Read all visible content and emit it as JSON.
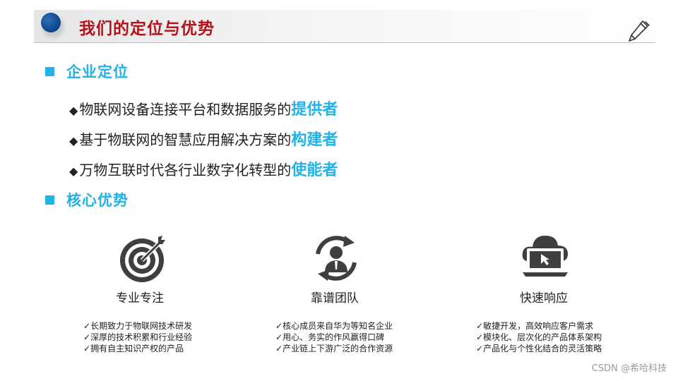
{
  "header": {
    "title": "我们的定位与优势"
  },
  "sections": [
    {
      "heading": "企业定位"
    },
    {
      "heading": "核心优势"
    }
  ],
  "positioning": [
    {
      "bullet": "◆",
      "text": "物联网设备连接平台和数据服务的",
      "highlight": "提供者"
    },
    {
      "bullet": "◆",
      "text": "基于物联网的智慧应用解决方案的",
      "highlight": "构建者"
    },
    {
      "bullet": "◆",
      "text": "万物互联时代各行业数字化转型的",
      "highlight": "使能者"
    }
  ],
  "advantages": [
    {
      "icon": "target-icon",
      "title": "专业专注",
      "points": [
        "长期致力于物联网技术研发",
        "深厚的技术积累和行业经验",
        "拥有自主知识产权的产品"
      ]
    },
    {
      "icon": "team-icon",
      "title": "靠谱团队",
      "points": [
        "核心成员来自华为等知名企业",
        "用心、务实的作风赢得口碑",
        "产业链上下游广泛的合作资源"
      ]
    },
    {
      "icon": "cloud-laptop-icon",
      "title": "快速响应",
      "points": [
        "敏捷开发，高效响应客户需求",
        "模块化、层次化的产品体系架构",
        "产品化与个性化结合的灵活策略"
      ]
    }
  ],
  "check_mark": "✓",
  "watermark": "CSDN @希哈科技",
  "colors": {
    "accent": "#1fb3e8",
    "title": "#b5121b",
    "icon": "#3f3f3f",
    "dot": "#0f4c92"
  }
}
